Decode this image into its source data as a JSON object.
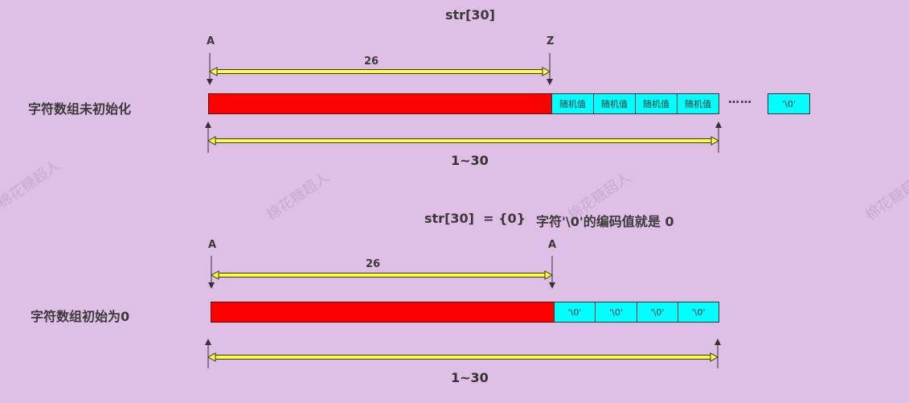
{
  "top": {
    "title": "str[30]",
    "label_start": "A",
    "label_end": "Z",
    "span_label": "26",
    "row_label": "字符数组未初始化",
    "cells": [
      "随机值",
      "随机值",
      "随机值",
      "随机值"
    ],
    "ellipsis": "……",
    "terminator": "'\\0'",
    "total_label": "1~30"
  },
  "bottom": {
    "title": "str[30]  = {0}",
    "note": "字符'\\0'的编码值就是 0",
    "label_start": "A",
    "label_end": "A",
    "span_label": "26",
    "row_label": "字符数组初始为0",
    "cells": [
      "'\\0'",
      "'\\0'",
      "'\\0'",
      "'\\0'"
    ],
    "total_label": "1~30"
  },
  "watermark": "棉花糖超人",
  "colors": {
    "background": "#e0bfe6",
    "filled": "#ff0000",
    "cell": "#00ffff",
    "arrow": "#ffff33"
  }
}
